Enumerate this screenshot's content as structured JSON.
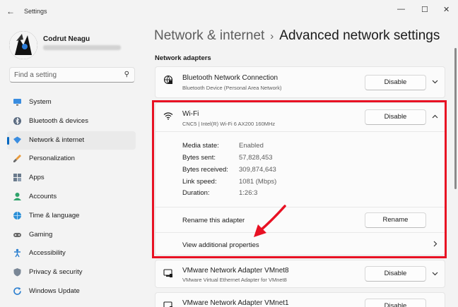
{
  "window": {
    "title": "Settings",
    "back_icon": "arrow-left-icon",
    "minimize_glyph": "—",
    "maximize_glyph": "☐",
    "close_glyph": "✕"
  },
  "profile": {
    "name": "Codrut Neagu"
  },
  "search": {
    "placeholder": "Find a setting"
  },
  "sidebar": {
    "items": [
      {
        "label": "System",
        "icon": "monitor-icon",
        "active": false
      },
      {
        "label": "Bluetooth & devices",
        "icon": "bluetooth-icon",
        "active": false
      },
      {
        "label": "Network & internet",
        "icon": "wifi-diamond-icon",
        "active": true
      },
      {
        "label": "Personalization",
        "icon": "brush-icon",
        "active": false
      },
      {
        "label": "Apps",
        "icon": "apps-icon",
        "active": false
      },
      {
        "label": "Accounts",
        "icon": "person-icon",
        "active": false
      },
      {
        "label": "Time & language",
        "icon": "globe-clock-icon",
        "active": false
      },
      {
        "label": "Gaming",
        "icon": "gamepad-icon",
        "active": false
      },
      {
        "label": "Accessibility",
        "icon": "accessibility-icon",
        "active": false
      },
      {
        "label": "Privacy & security",
        "icon": "shield-icon",
        "active": false
      },
      {
        "label": "Windows Update",
        "icon": "update-icon",
        "active": false
      }
    ]
  },
  "header": {
    "parent": "Network & internet",
    "separator": "›",
    "current": "Advanced network settings"
  },
  "section": {
    "title": "Network adapters"
  },
  "adapters": {
    "bluetooth": {
      "title": "Bluetooth Network Connection",
      "subtitle": "Bluetooth Device (Personal Area Network)",
      "button": "Disable"
    },
    "wifi": {
      "title": "Wi-Fi",
      "subtitle": "CNC5 | Intel(R) Wi-Fi 6 AX200 160MHz",
      "button": "Disable",
      "properties": [
        {
          "label": "Media state:",
          "value": "Enabled"
        },
        {
          "label": "Bytes sent:",
          "value": "57,828,453"
        },
        {
          "label": "Bytes received:",
          "value": "309,874,643"
        },
        {
          "label": "Link speed:",
          "value": "1081 (Mbps)"
        },
        {
          "label": "Duration:",
          "value": "1:26:3"
        }
      ],
      "rename_label": "Rename this adapter",
      "rename_button": "Rename",
      "more_label": "View additional properties"
    },
    "vmnet8": {
      "title": "VMware Network Adapter VMnet8",
      "subtitle": "VMware Virtual Ethernet Adapter for VMnet8",
      "button": "Disable"
    },
    "vmnet1": {
      "title": "VMware Network Adapter VMnet1",
      "button": "Disable"
    }
  },
  "colors": {
    "accent": "#0067c0",
    "highlight": "#e81123"
  }
}
